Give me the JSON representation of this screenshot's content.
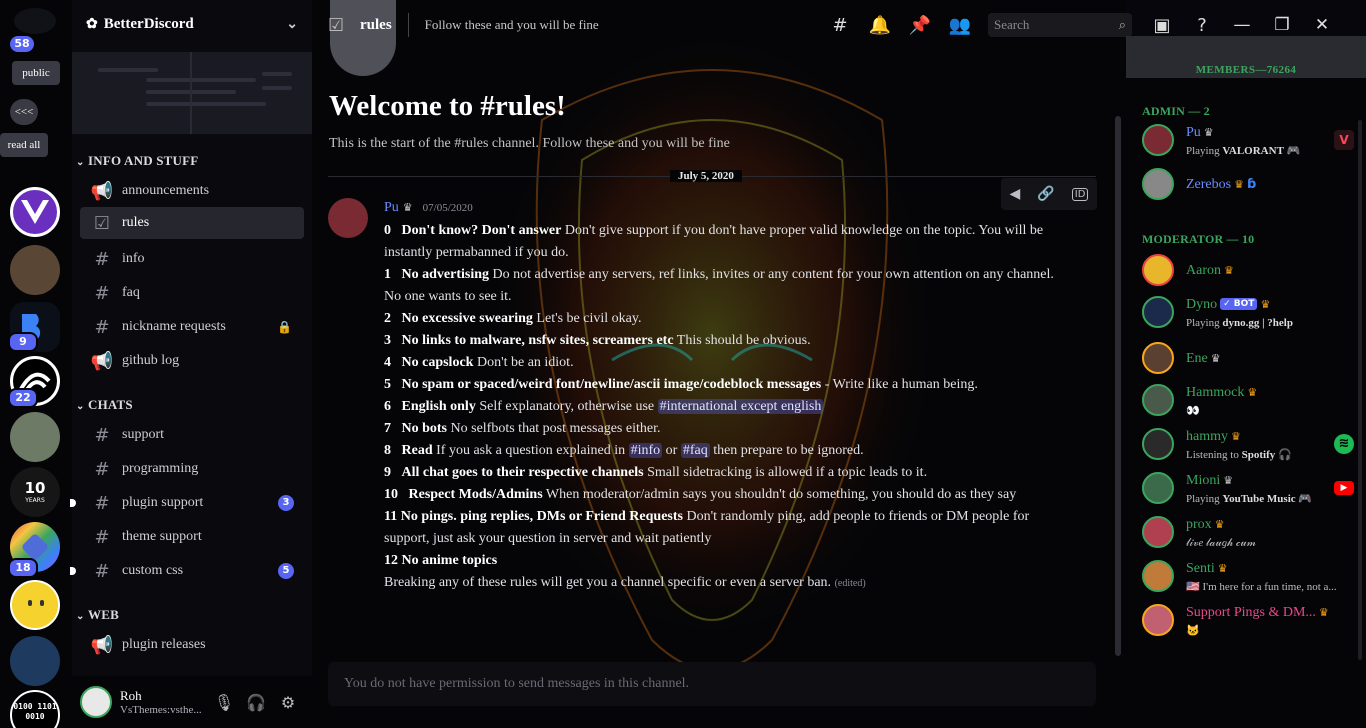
{
  "rail": {
    "mention_count": "58",
    "public_label": "public",
    "collapse_label": "<<<",
    "read_all_label": "read all",
    "badges": [
      "9",
      "22",
      "18"
    ],
    "years_label": "10",
    "years_sub": "YEARS",
    "binary_label": "0100 1101 0010"
  },
  "server": {
    "name": "BetterDiscord"
  },
  "categories": {
    "info": "INFO AND STUFF",
    "chats": "CHATS",
    "web": "WEB"
  },
  "channels": {
    "announcements": "announcements",
    "rules": "rules",
    "info": "info",
    "faq": "faq",
    "nickname": "nickname requests",
    "github": "github log",
    "support": "support",
    "programming": "programming",
    "plugin_support": "plugin support",
    "plugin_support_badge": "3",
    "theme_support": "theme support",
    "custom_css": "custom css",
    "custom_css_badge": "5",
    "plugin_releases": "plugin releases"
  },
  "user": {
    "name": "Roh",
    "status": "VsThemes:vsthe..."
  },
  "header": {
    "channel": "rules",
    "topic": "Follow these and you will be fine",
    "search_placeholder": "Search"
  },
  "welcome": {
    "title": "Welcome to #rules!",
    "subtitle": "This is the start of the #rules channel. Follow these and you will be fine"
  },
  "date_divider": "July 5, 2020",
  "message": {
    "author": "Pu",
    "timestamp": "07/05/2020",
    "rules": [
      {
        "n": "0",
        "title": "Don't know? Don't answer",
        "text": " Don't give support if you don't have proper valid knowledge on the topic. You will be instantly permabanned if you do."
      },
      {
        "n": "1",
        "title": "No advertising",
        "text": " Do not advertise any servers, ref links, invites or any content for your own attention on any channel. No one wants to see it."
      },
      {
        "n": "2",
        "title": "No excessive swearing",
        "text": " Let's be civil okay."
      },
      {
        "n": "3",
        "title": "No links to malware, nsfw sites, screamers etc",
        "text": " This should be obvious."
      },
      {
        "n": "4",
        "title": "No capslock",
        "text": " Don't be an idiot."
      },
      {
        "n": "5",
        "title": "No spam or spaced/weird font/newline/ascii image/codeblock messages",
        "text": " - Write like a human being."
      },
      {
        "n": "6",
        "title": "English only",
        "text": " Self explanatory, otherwise use ",
        "mention": "#international except english"
      },
      {
        "n": "7",
        "title": "No bots",
        "text": " No selfbots that post messages either."
      },
      {
        "n": "8",
        "title": "Read",
        "text": " If you ask a question explained in ",
        "mention": "#info",
        "mid": " or ",
        "mention2": "#faq",
        "tail": " then prepare to be ignored."
      },
      {
        "n": "9",
        "title": "All chat goes to their respective channels",
        "text": " Small sidetracking is allowed if a topic leads to it."
      },
      {
        "n": "10",
        "title": "Respect Mods/Admins",
        "text": " When moderator/admin says you shouldn't do something, you should do as they say"
      },
      {
        "n": "11",
        "title": "No pings. ping replies, DMs or Friend Requests",
        "text": " Don't randomly ping, add people to friends or DM people for support, just ask your question in server and wait patiently"
      }
    ],
    "rule12": "12 No anime topics",
    "footer": "Breaking any of these rules will get you a channel specific or even a server ban.",
    "edited": "(edited)"
  },
  "composer": {
    "placeholder": "You do not have permission to send messages in this channel."
  },
  "members": {
    "header": "MEMBERS—76264",
    "admin_head": "ADMIN — 2",
    "mod_head": "MODERATOR — 10",
    "list": [
      {
        "name": "Pu",
        "activity_prefix": "Playing ",
        "activity": "VALORANT",
        "color": "#6b8cff"
      },
      {
        "name": "Zerebos",
        "activity_prefix": "",
        "activity": "",
        "color": "#6b8cff"
      },
      {
        "name": "Aaron",
        "activity_prefix": "",
        "activity": "",
        "color": "#3ba55d"
      },
      {
        "name": "Dyno",
        "bot": "✓ BOT",
        "activity_prefix": "Playing ",
        "activity": "dyno.gg | ?help",
        "color": "#3ba55d"
      },
      {
        "name": "Ene",
        "activity_prefix": "",
        "activity": "",
        "color": "#3ba55d"
      },
      {
        "name": "Hammock",
        "activity_prefix": "",
        "activity": "👀",
        "color": "#3ba55d"
      },
      {
        "name": "hammy",
        "activity_prefix": "Listening to ",
        "activity": "Spotify",
        "color": "#3ba55d"
      },
      {
        "name": "Mioni",
        "activity_prefix": "Playing ",
        "activity": "YouTube Music",
        "color": "#3ba55d"
      },
      {
        "name": "prox",
        "activity_prefix": "",
        "activity": "𝓁𝒾𝓋𝑒 𝓁𝒶𝓊𝑔𝒽 𝒸𝓊𝓂",
        "color": "#3ba55d"
      },
      {
        "name": "Senti",
        "activity_prefix": "",
        "activity": "🇺🇸 I'm here for a fun time, not a...",
        "color": "#3ba55d"
      },
      {
        "name": "Support Pings & DM...",
        "activity_prefix": "",
        "activity": "",
        "color": "#e84a8c"
      }
    ]
  },
  "colors": {
    "accent": "#5865f2",
    "online": "#3ba55d",
    "mention_bg": "#3a3f8a"
  }
}
